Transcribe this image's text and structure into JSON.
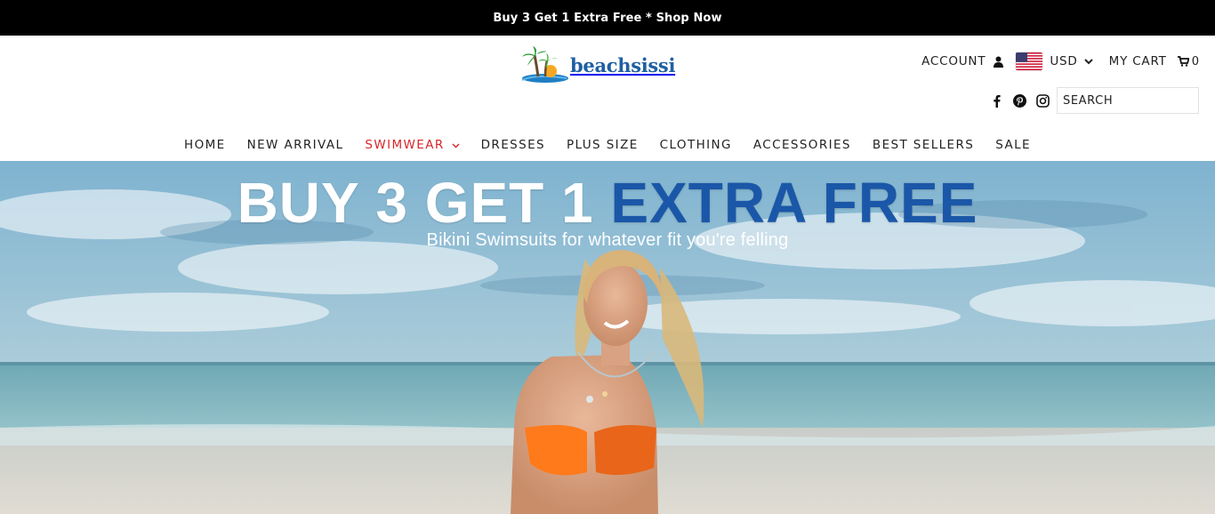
{
  "announcement": {
    "text": "Buy 3 Get 1 Extra Free * Shop Now"
  },
  "brand": {
    "name": "beachsissi",
    "logo_icon": "palm-tree-island-icon"
  },
  "header_utils": {
    "account_label": "ACCOUNT",
    "currency": "USD",
    "cart_label": "MY CART",
    "cart_count": "0"
  },
  "social": [
    "facebook-icon",
    "pinterest-icon",
    "instagram-icon"
  ],
  "search": {
    "placeholder": "SEARCH",
    "value": ""
  },
  "nav": {
    "items": [
      {
        "label": "HOME"
      },
      {
        "label": "NEW ARRIVAL"
      },
      {
        "label": "SWIMWEAR"
      },
      {
        "label": "DRESSES"
      },
      {
        "label": "PLUS SIZE"
      },
      {
        "label": "CLOTHING"
      },
      {
        "label": "ACCESSORIES"
      },
      {
        "label": "BEST SELLERS"
      },
      {
        "label": "SALE"
      }
    ],
    "active_index": 2
  },
  "hero": {
    "headline_white": "BUY 3 GET 1 ",
    "headline_blue": "EXTRA FREE",
    "subline": "Bikini Swimsuits for whatever fit you're felling"
  },
  "colors": {
    "accent_red": "#d7262b",
    "brand_blue": "#1f5fa3",
    "headline_blue": "#1b57a8"
  }
}
